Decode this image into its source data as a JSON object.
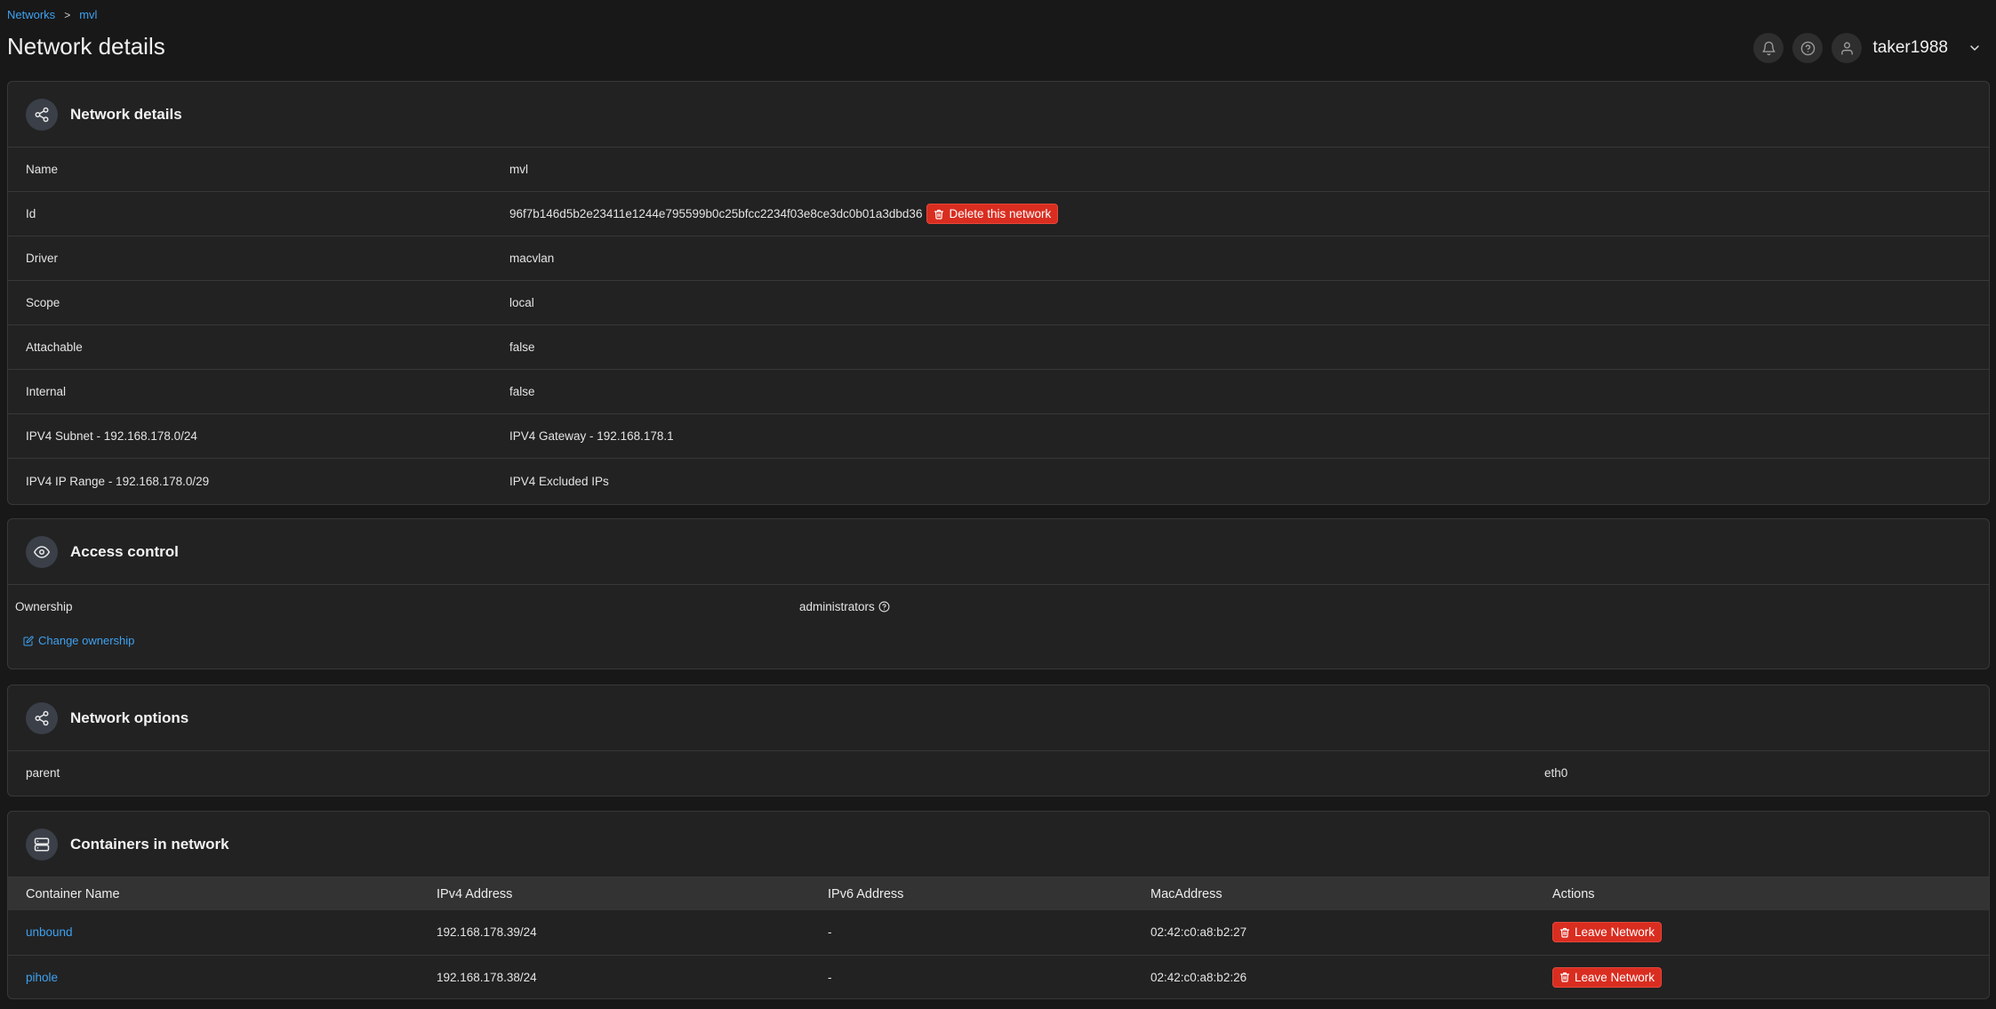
{
  "breadcrumb": {
    "root": "Networks",
    "separator": ">",
    "current": "mvl"
  },
  "page": {
    "title": "Network details"
  },
  "user": {
    "name": "taker1988"
  },
  "details": {
    "title": "Network details",
    "rows": [
      {
        "label": "Name",
        "value": "mvl"
      },
      {
        "label": "Id",
        "value": "96f7b146d5b2e23411e1244e795599b0c25bfcc2234f03e8ce3dc0b01a3dbd36"
      },
      {
        "label": "Driver",
        "value": "macvlan"
      },
      {
        "label": "Scope",
        "value": "local"
      },
      {
        "label": "Attachable",
        "value": "false"
      },
      {
        "label": "Internal",
        "value": "false"
      },
      {
        "label": "IPV4 Subnet - 192.168.178.0/24",
        "value": "IPV4 Gateway - 192.168.178.1"
      },
      {
        "label": "IPV4 IP Range - 192.168.178.0/29",
        "value": "IPV4 Excluded IPs"
      }
    ],
    "delete_label": "Delete this network"
  },
  "access": {
    "title": "Access control",
    "ownership_label": "Ownership",
    "ownership_value": "administrators",
    "change_label": "Change ownership"
  },
  "options": {
    "title": "Network options",
    "key": "parent",
    "value": "eth0"
  },
  "containers": {
    "title": "Containers in network",
    "columns": [
      "Container Name",
      "IPv4 Address",
      "IPv6 Address",
      "MacAddress",
      "Actions"
    ],
    "rows": [
      {
        "name": "unbound",
        "ipv4": "192.168.178.39/24",
        "ipv6": "-",
        "mac": "02:42:c0:a8:b2:27",
        "action": "Leave Network"
      },
      {
        "name": "pihole",
        "ipv4": "192.168.178.38/24",
        "ipv6": "-",
        "mac": "02:42:c0:a8:b2:26",
        "action": "Leave Network"
      }
    ]
  },
  "colors": {
    "accent": "#3ea1f0",
    "danger": "#d92d20",
    "background": "#181818",
    "card": "#222222"
  }
}
